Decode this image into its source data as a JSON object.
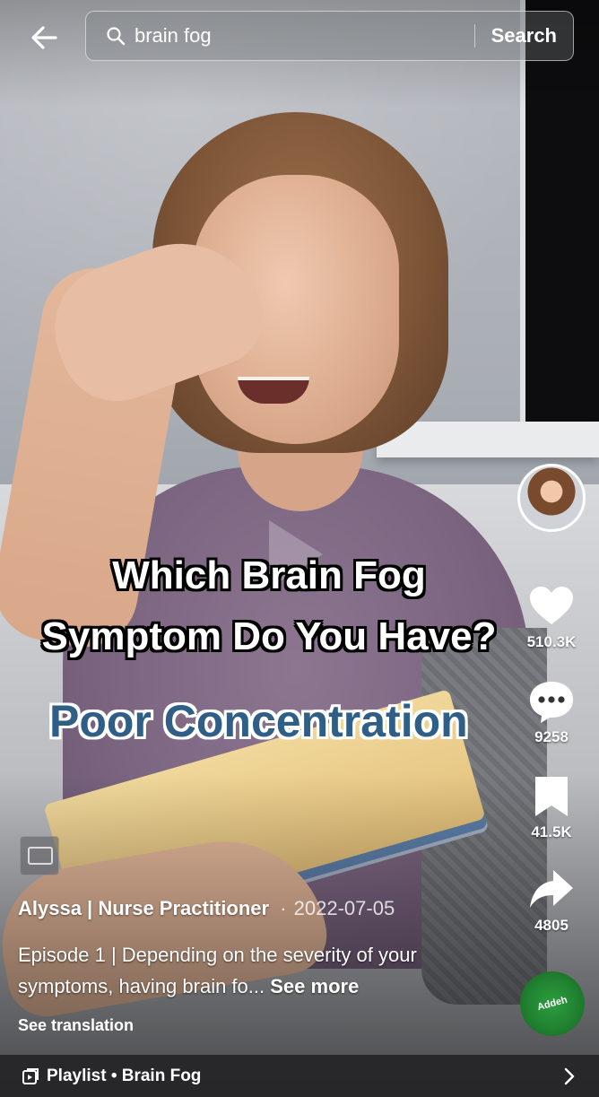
{
  "search": {
    "query": "brain fog",
    "button_label": "Search"
  },
  "video": {
    "caption_line1": "Which Brain Fog",
    "caption_line2": "Symptom Do You Have?",
    "caption_highlight": "Poor Concentration"
  },
  "actions": {
    "likes": "510.3K",
    "comments": "9258",
    "saves": "41.5K",
    "shares": "4805"
  },
  "music_disc_label": "Addeh",
  "post": {
    "author": "Alyssa | Nurse Practitioner",
    "separator": "·",
    "date": "2022-07-05",
    "description": "Episode 1 | Depending on the severity of your symptoms, having brain fo...",
    "see_more": "See more",
    "see_translation": "See translation"
  },
  "playlist": {
    "label": "Playlist • Brain Fog"
  },
  "icons": {
    "back": "arrow-left-icon",
    "search": "search-icon",
    "like": "heart-icon",
    "comment": "comment-icon",
    "save": "bookmark-icon",
    "share": "share-icon",
    "subtitles": "captions-icon",
    "playlist": "playlist-icon",
    "chevron": "chevron-right-icon"
  }
}
